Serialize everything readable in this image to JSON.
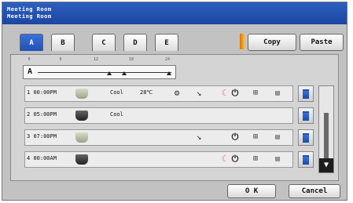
{
  "title": {
    "line1": "Meeting Room",
    "line2": "Meeting Room"
  },
  "tabs": [
    {
      "label": "A",
      "active": true
    },
    {
      "label": "B",
      "active": false
    },
    {
      "label": "C",
      "active": false
    },
    {
      "label": "D",
      "active": false
    },
    {
      "label": "E",
      "active": false
    }
  ],
  "toolbar": {
    "copy_label": "Copy",
    "paste_label": "Paste"
  },
  "timeline": {
    "label": "A",
    "ticks": [
      "0",
      "6",
      "12",
      "18",
      "24"
    ]
  },
  "rows": [
    {
      "index": "1",
      "time": "00:00PM",
      "fan": "on",
      "mode": "Cool",
      "temp": "28℃",
      "icons": [
        "fan-speed-icon",
        "vane-icon",
        "sleep-icon",
        "power-icon",
        "grid-icon",
        "bars-icon"
      ]
    },
    {
      "index": "2",
      "time": "05:00PM",
      "fan": "off",
      "mode": "Cool",
      "temp": "",
      "icons": []
    },
    {
      "index": "3",
      "time": "07:00PM",
      "fan": "on",
      "mode": "",
      "temp": "",
      "icons": [
        "vane-icon",
        "power-icon",
        "grid-icon",
        "bars-icon"
      ]
    },
    {
      "index": "4",
      "time": "00:00AM",
      "fan": "off",
      "mode": "",
      "temp": "",
      "icons": [
        "sleep-icon",
        "power-icon",
        "grid-icon",
        "bars-icon"
      ]
    }
  ],
  "footer": {
    "ok_label": "O K",
    "cancel_label": "Cancel"
  },
  "colors": {
    "title_bar": "#1c46a0",
    "active_tab": "#2050b8",
    "separator": "#e07000",
    "pink_icon": "#e06080"
  }
}
